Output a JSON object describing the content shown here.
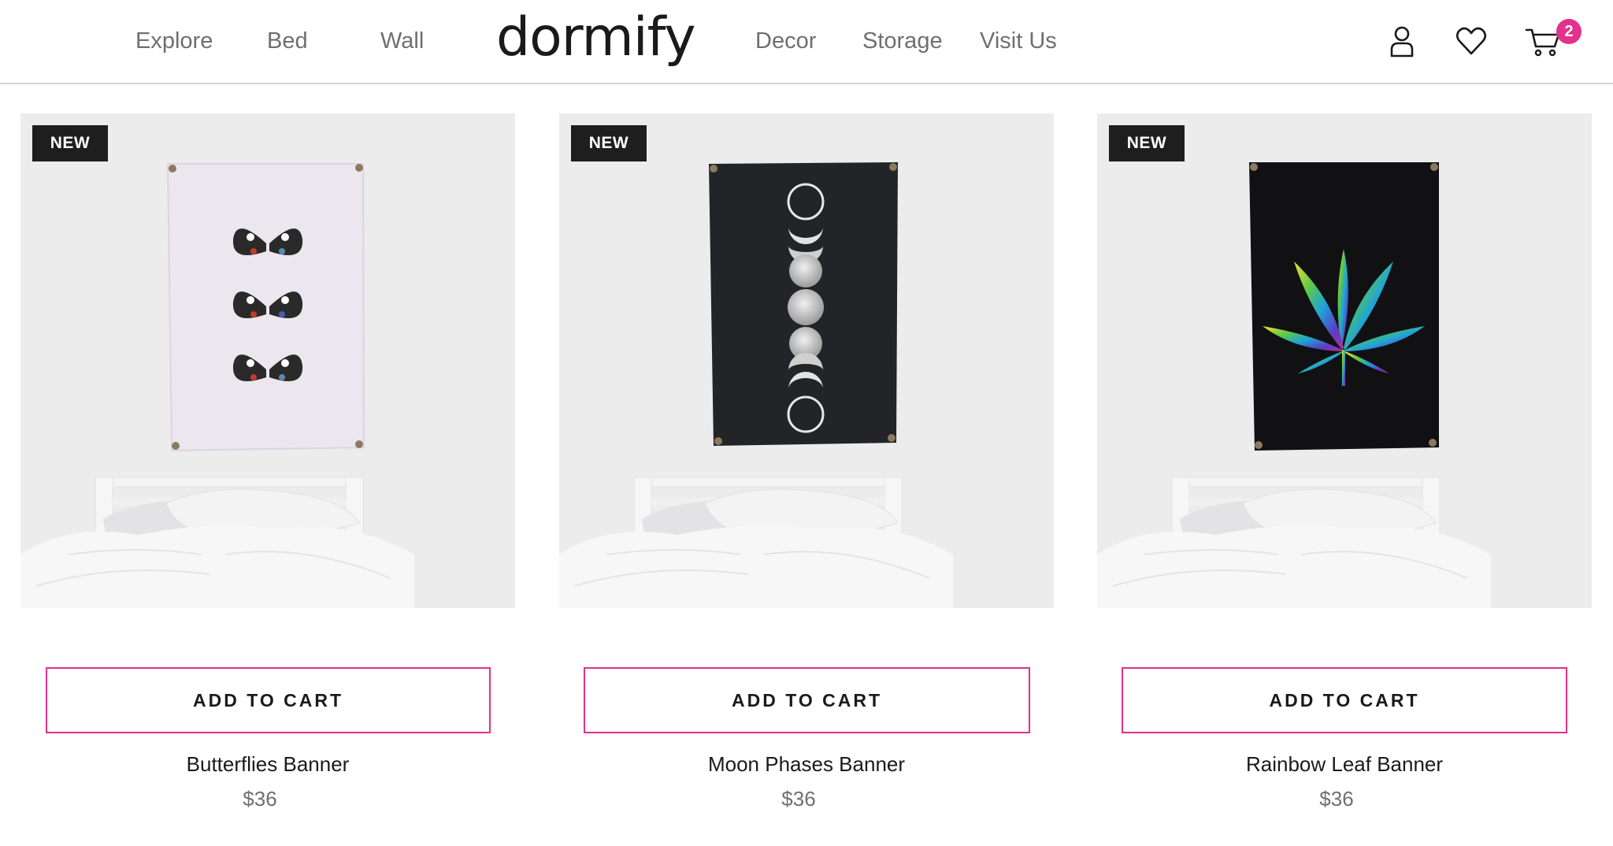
{
  "header": {
    "nav_left": [
      "Explore",
      "Bed",
      "Wall"
    ],
    "logo": "dormify",
    "nav_right": [
      "Decor",
      "Storage",
      "Visit Us"
    ],
    "icons": [
      "user-icon",
      "heart-icon",
      "cart-icon"
    ],
    "cart_count": "2"
  },
  "colors": {
    "accent": "#e3318d",
    "badge_bg": "#1e1e1e",
    "nav_text": "#6f6f6f"
  },
  "products": [
    {
      "badge": "NEW",
      "button": "ADD TO CART",
      "name": "Butterflies Banner",
      "price": "$36"
    },
    {
      "badge": "NEW",
      "button": "ADD TO CART",
      "name": "Moon Phases Banner",
      "price": "$36"
    },
    {
      "badge": "NEW",
      "button": "ADD TO CART",
      "name": "Rainbow Leaf Banner",
      "price": "$36"
    }
  ]
}
